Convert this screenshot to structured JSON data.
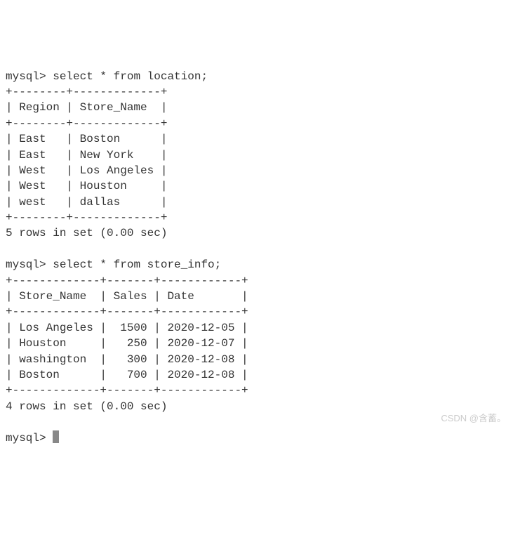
{
  "query1": {
    "prompt": "mysql>",
    "command": "select * from location;",
    "sep_top": "+--------+-------------+",
    "header": "| Region | Store_Name  |",
    "sep_mid": "+--------+-------------+",
    "rows": [
      "| East   | Boston      |",
      "| East   | New York    |",
      "| West   | Los Angeles |",
      "| West   | Houston     |",
      "| west   | dallas      |"
    ],
    "sep_bot": "+--------+-------------+",
    "summary": "5 rows in set (0.00 sec)"
  },
  "query2": {
    "prompt": "mysql>",
    "command": "select * from store_info;",
    "sep_top": "+-------------+-------+------------+",
    "header": "| Store_Name  | Sales | Date       |",
    "sep_mid": "+-------------+-------+------------+",
    "rows": [
      "| Los Angeles |  1500 | 2020-12-05 |",
      "| Houston     |   250 | 2020-12-07 |",
      "| washington  |   300 | 2020-12-08 |",
      "| Boston      |   700 | 2020-12-08 |"
    ],
    "sep_bot": "+-------------+-------+------------+",
    "summary": "4 rows in set (0.00 sec)"
  },
  "final_prompt": "mysql>",
  "watermark": "CSDN @含蓄。",
  "chart_data": [
    {
      "type": "table",
      "title": "location",
      "columns": [
        "Region",
        "Store_Name"
      ],
      "rows": [
        [
          "East",
          "Boston"
        ],
        [
          "East",
          "New York"
        ],
        [
          "West",
          "Los Angeles"
        ],
        [
          "West",
          "Houston"
        ],
        [
          "west",
          "dallas"
        ]
      ]
    },
    {
      "type": "table",
      "title": "store_info",
      "columns": [
        "Store_Name",
        "Sales",
        "Date"
      ],
      "rows": [
        [
          "Los Angeles",
          1500,
          "2020-12-05"
        ],
        [
          "Houston",
          250,
          "2020-12-07"
        ],
        [
          "washington",
          300,
          "2020-12-08"
        ],
        [
          "Boston",
          700,
          "2020-12-08"
        ]
      ]
    }
  ]
}
